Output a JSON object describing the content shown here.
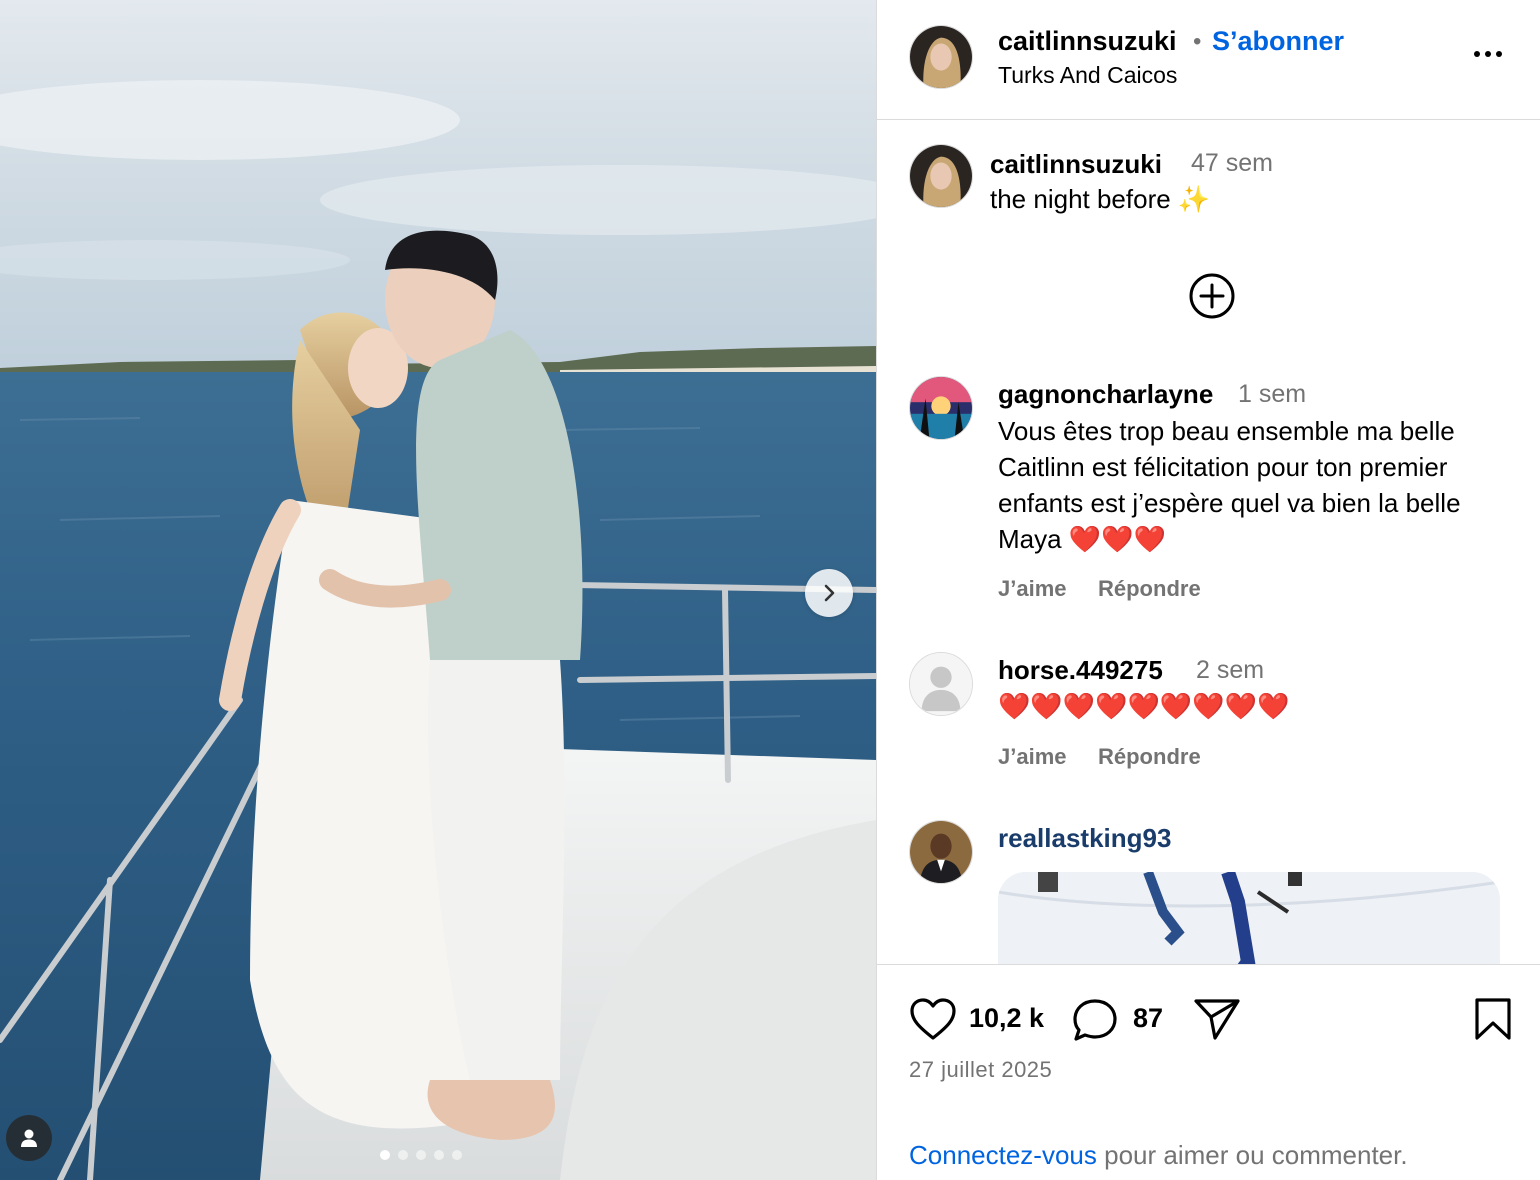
{
  "colors": {
    "link_blue": "#0064e0",
    "muted": "#737373",
    "border": "#dbdbdb",
    "heart_red": "#e0245e"
  },
  "post": {
    "author": "caitlinnsuzuki",
    "separator": "•",
    "follow_label": "S’abonner",
    "location": "Turks And Caicos",
    "caption": {
      "user": "caitlinnsuzuki",
      "time": "47 sem",
      "text": "the night before ✨"
    },
    "comments": [
      {
        "user": "gagnoncharlayne",
        "time": "1 sem",
        "text": "Vous êtes trop beau ensemble ma belle Caitlinn est félicitation pour ton premier enfants est j’espère quel va bien la belle Maya ❤️❤️❤️",
        "like_label": "J’aime",
        "reply_label": "Répondre"
      },
      {
        "user": "horse.449275",
        "time": "2 sem",
        "text": "❤️❤️❤️❤️❤️❤️❤️❤️❤️",
        "like_label": "J’aime",
        "reply_label": "Répondre"
      },
      {
        "user": "reallastking93",
        "text": "",
        "media": "gif"
      }
    ],
    "likes": "10,2 k",
    "comment_count": "87",
    "date": "27 juillet 2025",
    "login_prompt": {
      "link": "Connectez-vous",
      "rest": " pour aimer ou commenter."
    },
    "carousel": {
      "count": 5,
      "active_index": 0
    }
  },
  "icons": {
    "more": "more-horizontal-icon",
    "load_more": "plus-circle-icon",
    "like": "heart-icon",
    "comment": "comment-bubble-icon",
    "share": "send-icon",
    "save": "bookmark-icon",
    "next": "chevron-right-icon",
    "tagged": "user-tag-icon"
  }
}
